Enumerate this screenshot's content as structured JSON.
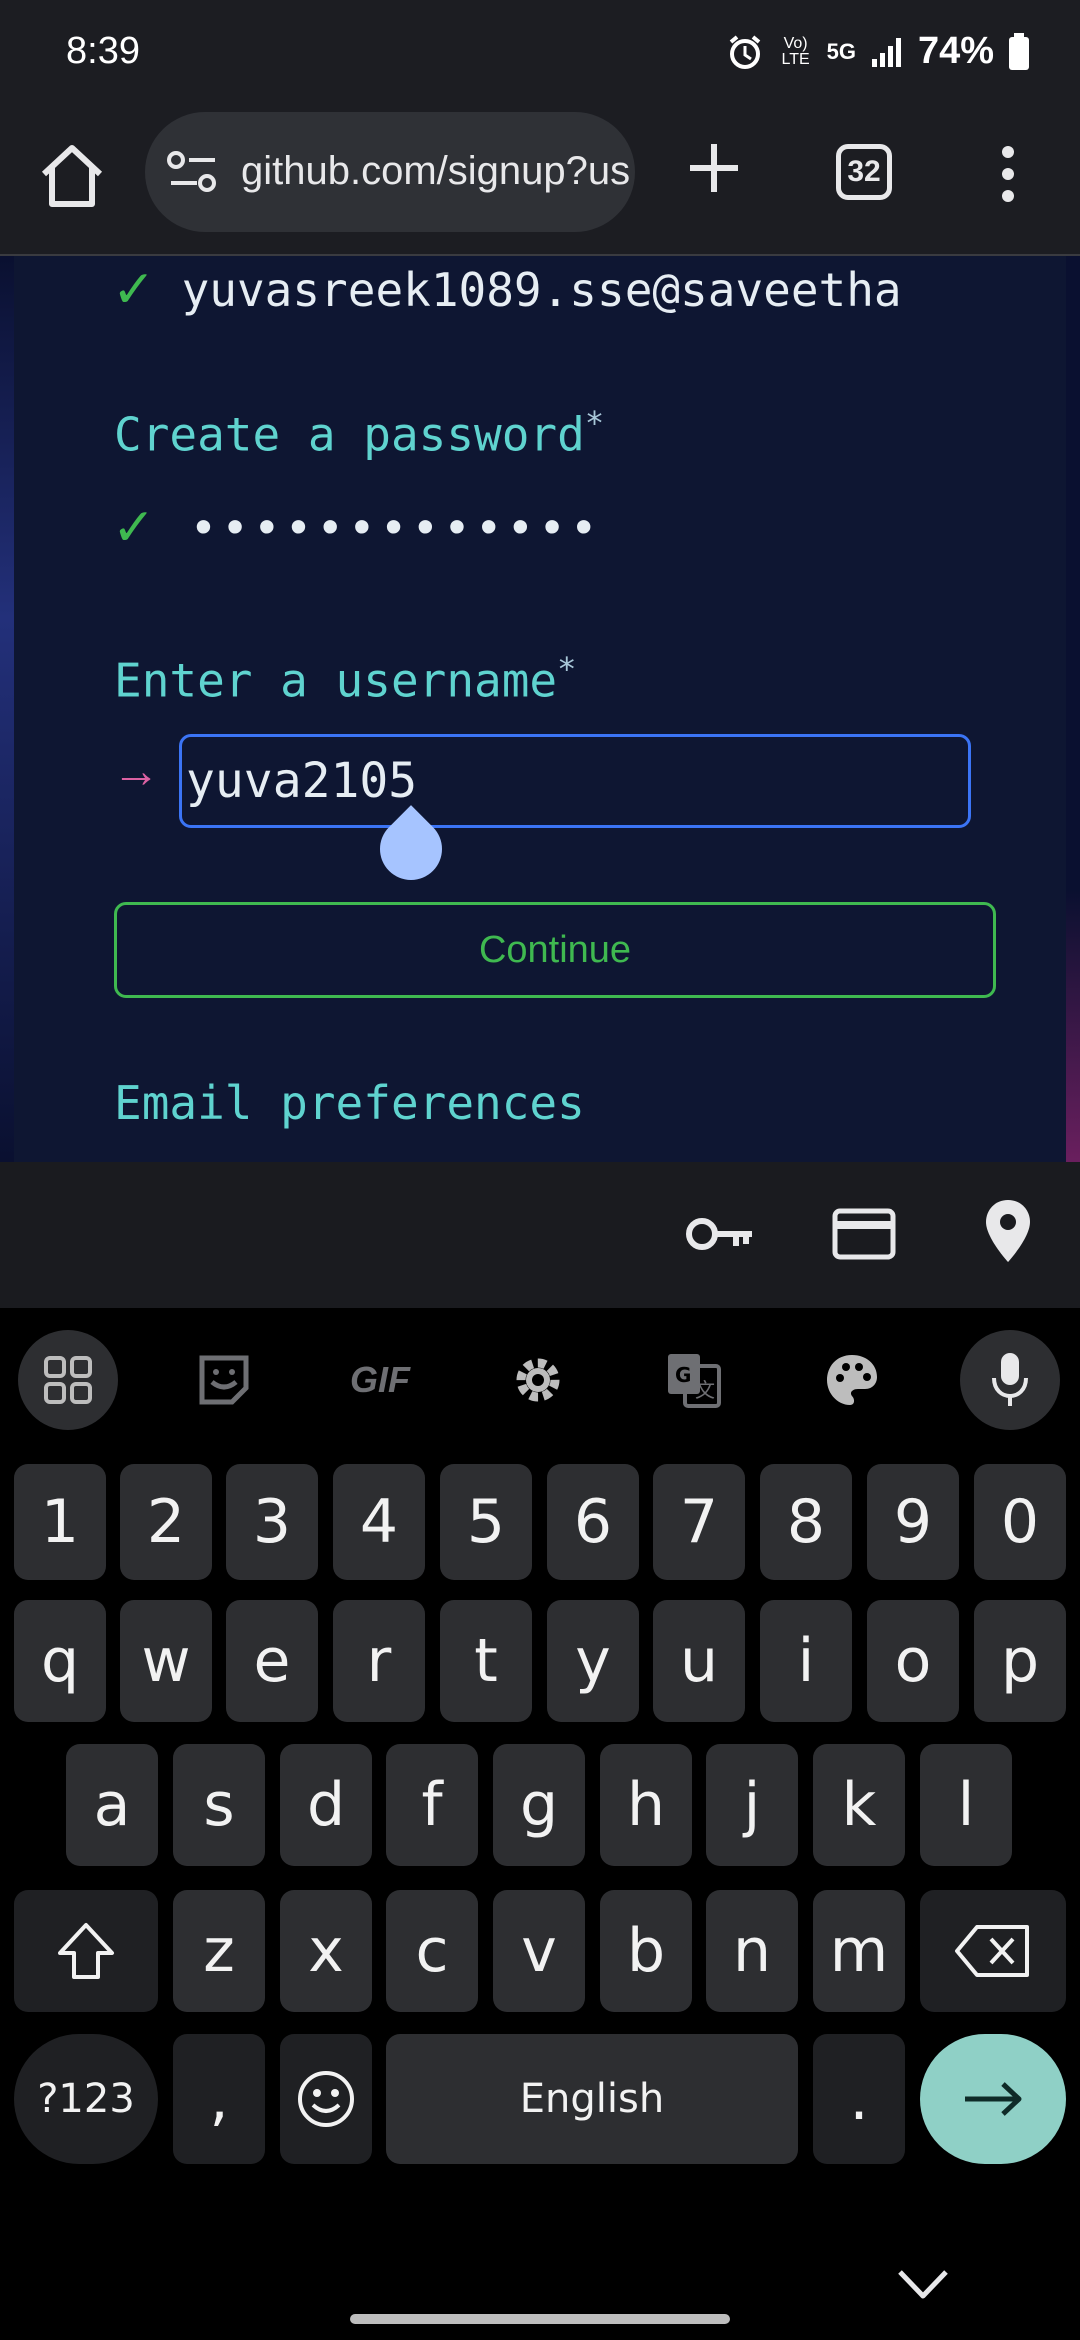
{
  "status_bar": {
    "time": "8:39",
    "network": "5G",
    "volte": "Vo) LTE",
    "battery": "74%"
  },
  "browser": {
    "url": "github.com/signup?us",
    "tab_count": "32"
  },
  "form": {
    "email_value": "yuvasreek1089.sse@saveetha",
    "password_label": "Create a password",
    "password_asterisk": "*",
    "password_mask": "•••••••••••••",
    "username_label": "Enter a username",
    "username_asterisk": "*",
    "username_value": "yuva2105",
    "continue_label": "Continue",
    "email_prefs_label": "Email preferences",
    "check_glyph": "✓",
    "arrow_glyph": "→"
  },
  "keyboard": {
    "gif_label": "GIF",
    "number_row": [
      "1",
      "2",
      "3",
      "4",
      "5",
      "6",
      "7",
      "8",
      "9",
      "0"
    ],
    "row1": [
      "q",
      "w",
      "e",
      "r",
      "t",
      "y",
      "u",
      "i",
      "o",
      "p"
    ],
    "row2": [
      "a",
      "s",
      "d",
      "f",
      "g",
      "h",
      "j",
      "k",
      "l"
    ],
    "row3": [
      "z",
      "x",
      "c",
      "v",
      "b",
      "n",
      "m"
    ],
    "symbols_label": "?123",
    "comma": ",",
    "space_label": "English",
    "period": "."
  },
  "colors": {
    "accent_green": "#3fb950",
    "label_teal": "#5fd3cf",
    "focus_blue": "#3b74f5",
    "arrow_pink": "#db61a2",
    "enter_key": "#8fd0c6"
  }
}
